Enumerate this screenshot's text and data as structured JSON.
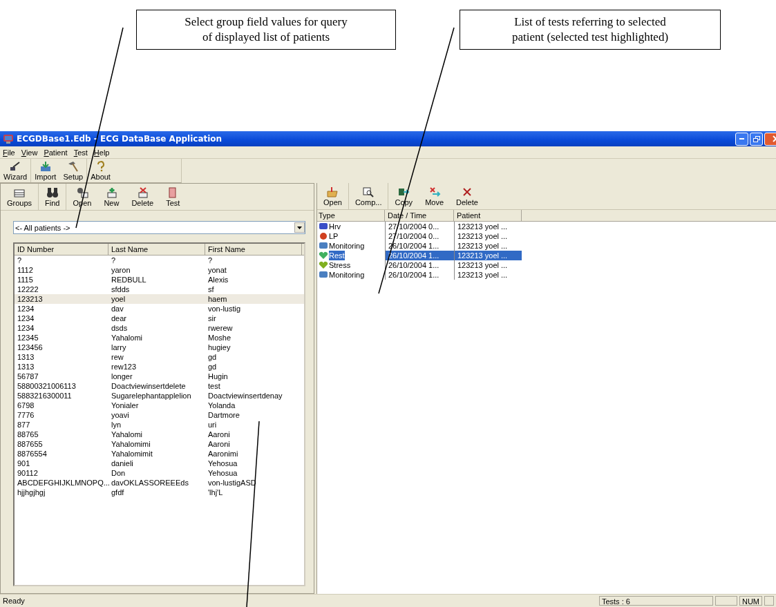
{
  "callouts": [
    {
      "lines": [
        "Select group field values for query",
        "of displayed list of patients"
      ]
    },
    {
      "lines": [
        "List of tests referring to selected",
        "patient (selected test highlighted)"
      ]
    }
  ],
  "window": {
    "title": "ECGDBase1.Edb - ECG DataBase Application"
  },
  "menu": [
    "File",
    "View",
    "Patient",
    "Test",
    "Help"
  ],
  "main_toolbar": [
    "Wizard",
    "Import",
    "Setup",
    "About"
  ],
  "patients_panel": {
    "toolbar": [
      "Groups",
      "Find",
      "Open",
      "New",
      "Delete",
      "Test"
    ],
    "group_filter": {
      "value": "<- All patients ->"
    },
    "columns": [
      "ID Number",
      "Last Name",
      "First Name"
    ],
    "rows": [
      {
        "cells": [
          "?",
          "?",
          "?"
        ],
        "selected": false
      },
      {
        "cells": [
          "1112",
          "yaron",
          "yonat"
        ],
        "selected": false
      },
      {
        "cells": [
          "1115",
          "REDBULL",
          "Alexis"
        ],
        "selected": false
      },
      {
        "cells": [
          "12222",
          "sfdds",
          "sf"
        ],
        "selected": false
      },
      {
        "cells": [
          "123213",
          "yoel",
          "haem"
        ],
        "selected": true
      },
      {
        "cells": [
          "1234",
          "dav",
          "von-lustig"
        ],
        "selected": false
      },
      {
        "cells": [
          "1234",
          "dear",
          "sir"
        ],
        "selected": false
      },
      {
        "cells": [
          "1234",
          "dsds",
          "rwerew"
        ],
        "selected": false
      },
      {
        "cells": [
          "12345",
          "Yahalomi",
          "Moshe"
        ],
        "selected": false
      },
      {
        "cells": [
          "123456",
          "larry",
          "hugiey"
        ],
        "selected": false
      },
      {
        "cells": [
          "1313",
          "rew",
          "gd"
        ],
        "selected": false
      },
      {
        "cells": [
          "1313",
          "rew123",
          "gd"
        ],
        "selected": false
      },
      {
        "cells": [
          "56787",
          "longer",
          "Hugin"
        ],
        "selected": false
      },
      {
        "cells": [
          "58800321006113",
          "Doactviewinsertdelete",
          "test"
        ],
        "selected": false
      },
      {
        "cells": [
          "5883216300011",
          "Sugarelephantapplelion",
          "Doactviewinsertdenay"
        ],
        "selected": false
      },
      {
        "cells": [
          "6798",
          "Yonialer",
          "Yolanda"
        ],
        "selected": false
      },
      {
        "cells": [
          "7776",
          "yoavi",
          "Dartmore"
        ],
        "selected": false
      },
      {
        "cells": [
          "877",
          "lyn",
          "uri"
        ],
        "selected": false
      },
      {
        "cells": [
          "88765",
          "Yahalomi",
          "Aaroni"
        ],
        "selected": false
      },
      {
        "cells": [
          "887655",
          "Yahalomimi",
          "Aaroni"
        ],
        "selected": false
      },
      {
        "cells": [
          "8876554",
          "Yahalomimit",
          "Aaronimi"
        ],
        "selected": false
      },
      {
        "cells": [
          "901",
          "danieli",
          "Yehosua"
        ],
        "selected": false
      },
      {
        "cells": [
          "90112",
          "Don",
          "Yehosua"
        ],
        "selected": false
      },
      {
        "cells": [
          "ABCDEFGHIJKLMNOPQ...",
          "davOKLASSOREEEds",
          "von-lustigASD"
        ],
        "selected": false
      },
      {
        "cells": [
          "hjjhgjhgj",
          "gfdf",
          "'lhj'L"
        ],
        "selected": false
      }
    ]
  },
  "tests_panel": {
    "toolbar": [
      "Open",
      "Comp...",
      "Copy",
      "Move",
      "Delete"
    ],
    "columns": [
      "Type",
      "Date / Time",
      "Patient"
    ],
    "rows": [
      {
        "kind": "hrv",
        "type": "Hrv",
        "date": "27/10/2004 0...",
        "patient": "123213 yoel ...",
        "selected": false
      },
      {
        "kind": "lp",
        "type": "LP",
        "date": "27/10/2004 0...",
        "patient": "123213 yoel ...",
        "selected": false
      },
      {
        "kind": "monitoring",
        "type": "Monitoring",
        "date": "26/10/2004 1...",
        "patient": "123213 yoel ...",
        "selected": false
      },
      {
        "kind": "rest",
        "type": "Rest",
        "date": "26/10/2004 1...",
        "patient": "123213 yoel ...",
        "selected": true
      },
      {
        "kind": "stress",
        "type": "Stress",
        "date": "26/10/2004 1...",
        "patient": "123213 yoel ...",
        "selected": false
      },
      {
        "kind": "monitoring",
        "type": "Monitoring",
        "date": "26/10/2004 1...",
        "patient": "123213 yoel ...",
        "selected": false
      }
    ]
  },
  "status_bar": {
    "message": "Ready",
    "tests": "Tests : 6",
    "num": "NUM"
  }
}
